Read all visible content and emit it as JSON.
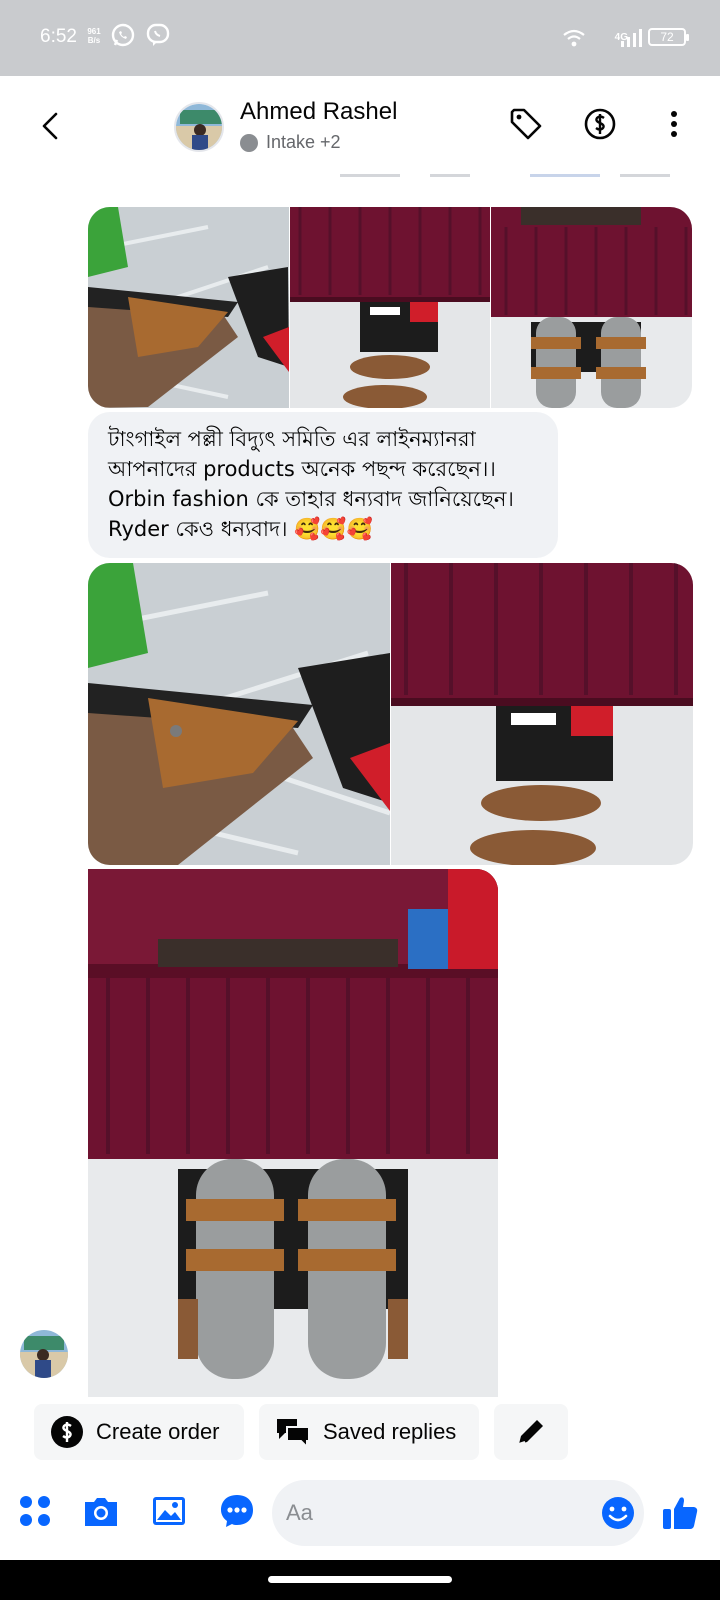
{
  "status_bar": {
    "time": "6:52",
    "speed_value": "961",
    "speed_unit": "B/s",
    "network": "4G",
    "battery": "72"
  },
  "header": {
    "name": "Ahmed Rashel",
    "subtitle": "Intake +2"
  },
  "message": {
    "text": "টাংগাইল পল্লী বিদ্যুৎ সমিতি এর লাইনম্যানরা আপনাদের products অনেক পছন্দ করেছেন।। Orbin fashion কে তাহার ধন্যবাদ জানিয়েছেন। Ryder কেও ধন্যবাদ। 🥰🥰🥰"
  },
  "quick_actions": {
    "create_order": "Create order",
    "saved_replies": "Saved replies"
  },
  "composer": {
    "placeholder": "Aa"
  },
  "colors": {
    "accent": "#0866ff",
    "bubble": "#f0f2f5",
    "maroon": "#6e1230"
  },
  "icons": [
    "back-chevron-icon",
    "tag-icon",
    "dollar-icon",
    "more-vertical-icon",
    "apps-icon",
    "camera-icon",
    "gallery-icon",
    "chat-bubble-icon",
    "emoji-icon",
    "thumbs-up-icon",
    "pencil-icon"
  ]
}
